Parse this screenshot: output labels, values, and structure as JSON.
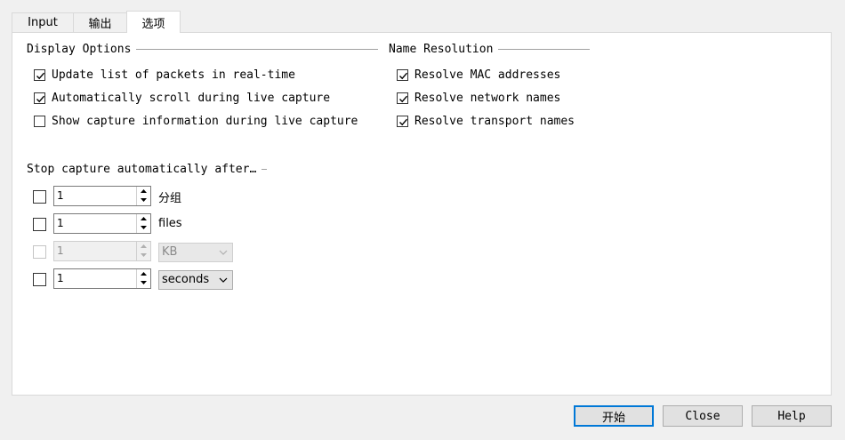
{
  "tabs": [
    {
      "label": "Input"
    },
    {
      "label": "输出"
    },
    {
      "label": "选项"
    }
  ],
  "display_options": {
    "title": "Display Options",
    "items": [
      {
        "label": "Update list of packets in real-time",
        "checked": true
      },
      {
        "label": "Automatically scroll during live capture",
        "checked": true
      },
      {
        "label": "Show capture information during live capture",
        "checked": false
      }
    ]
  },
  "name_resolution": {
    "title": "Name Resolution",
    "items": [
      {
        "label": "Resolve MAC addresses",
        "checked": true
      },
      {
        "label": "Resolve network names",
        "checked": true
      },
      {
        "label": "Resolve transport names",
        "checked": true
      }
    ]
  },
  "stop_capture": {
    "title": "Stop capture automatically after…",
    "rows": [
      {
        "checked": false,
        "value": "1",
        "unit": "分组",
        "enabled": true
      },
      {
        "checked": false,
        "value": "1",
        "unit": "files",
        "enabled": true
      },
      {
        "checked": false,
        "value": "1",
        "unit": "KB",
        "enabled": false
      },
      {
        "checked": false,
        "value": "1",
        "unit": "seconds",
        "enabled": true
      }
    ]
  },
  "buttons": {
    "start": "开始",
    "close": "Close",
    "help": "Help"
  }
}
